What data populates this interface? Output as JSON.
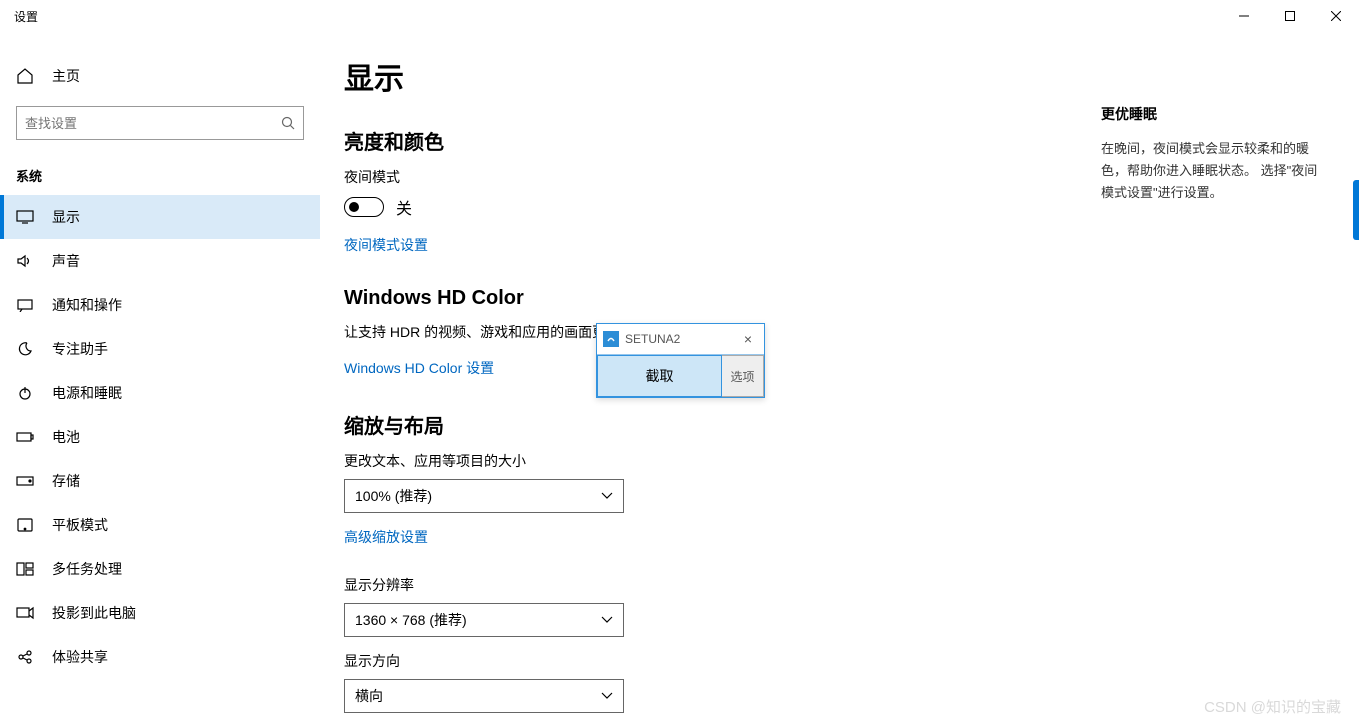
{
  "window": {
    "title": "设置"
  },
  "sidebar": {
    "home": "主页",
    "search_placeholder": "查找设置",
    "section": "系统",
    "items": [
      {
        "label": "显示"
      },
      {
        "label": "声音"
      },
      {
        "label": "通知和操作"
      },
      {
        "label": "专注助手"
      },
      {
        "label": "电源和睡眠"
      },
      {
        "label": "电池"
      },
      {
        "label": "存储"
      },
      {
        "label": "平板模式"
      },
      {
        "label": "多任务处理"
      },
      {
        "label": "投影到此电脑"
      },
      {
        "label": "体验共享"
      }
    ]
  },
  "main": {
    "title": "显示",
    "brightness_header": "亮度和颜色",
    "night_mode_label": "夜间模式",
    "night_mode_state": "关",
    "night_mode_link": "夜间模式设置",
    "hdcolor_header": "Windows HD Color",
    "hdcolor_desc": "让支持 HDR 的视频、游戏和应用的画面更",
    "hdcolor_link": "Windows HD Color 设置",
    "scale_header": "缩放与布局",
    "scale_label": "更改文本、应用等项目的大小",
    "scale_value": "100% (推荐)",
    "scale_link": "高级缩放设置",
    "resolution_label": "显示分辨率",
    "resolution_value": "1360 × 768 (推荐)",
    "orientation_label": "显示方向",
    "orientation_value": "横向"
  },
  "tip": {
    "title": "更优睡眠",
    "body": "在晚间，夜间模式会显示较柔和的暖色，帮助你进入睡眠状态。 选择\"夜间模式设置\"进行设置。"
  },
  "dialog": {
    "title": "SETUNA2",
    "main_btn": "截取",
    "side_btn": "选项"
  },
  "watermark": "CSDN @知识的宝藏"
}
